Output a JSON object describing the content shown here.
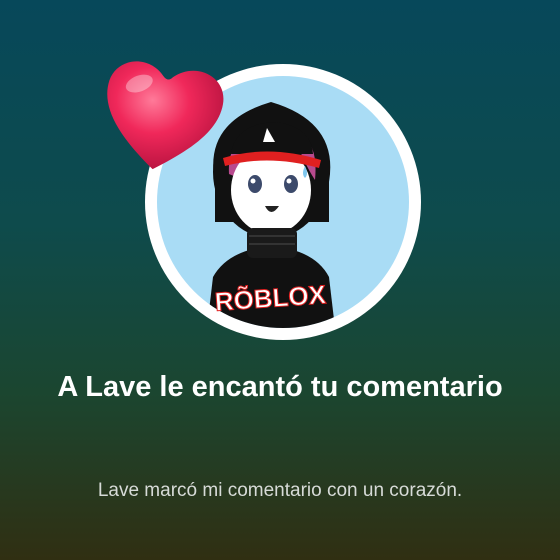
{
  "notification": {
    "title": "A Lave le encantó tu comentario",
    "body": "Lave marcó mi comentario con un corazón.",
    "icon": "heart-icon",
    "avatar_logo_text": "RÕBLOX"
  },
  "colors": {
    "avatar_ring": "#ffffff",
    "avatar_background": "#a9dcf5",
    "heart": "#f0285a",
    "title_text": "#ffffff",
    "body_text": "#d7dbd8"
  }
}
